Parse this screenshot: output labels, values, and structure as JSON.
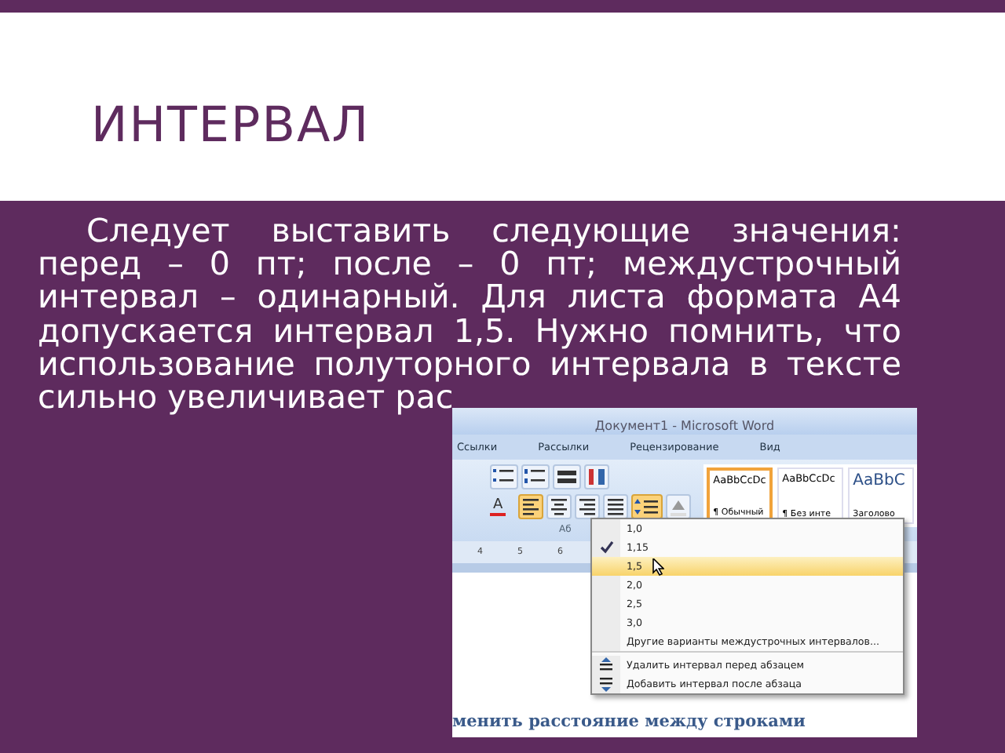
{
  "slide": {
    "title": "ИНТЕРВАЛ",
    "paragraph": "Следует выставить следующие значения: перед – 0 пт; после – 0 пт; междустрочный интервал – одинарный. Для листа формата А4 допускается интервал 1,5. Нужно помнить, что использование полуторного интервала в тексте сильно увеличивает рас"
  },
  "screenshot": {
    "window_title": "Документ1 - Microsoft Word",
    "tabs": [
      {
        "label": "Ссылки"
      },
      {
        "label": "Рассылки"
      },
      {
        "label": "Рецензирование"
      },
      {
        "label": "Вид"
      }
    ],
    "font_color_glyph": "A",
    "group_label": "Аб",
    "styles": [
      {
        "sample": "AaBbCcDc",
        "name": "¶ Обычный",
        "selected": true
      },
      {
        "sample": "AaBbCcDc",
        "name": "¶ Без инте",
        "selected": false
      },
      {
        "sample": "AaBbC",
        "name": "Заголово",
        "selected": false
      }
    ],
    "ruler_labels": [
      "4",
      "5",
      "6"
    ],
    "menu": [
      {
        "kind": "value",
        "label": "1,0",
        "checked": false,
        "selected": false
      },
      {
        "kind": "value",
        "label": "1,15",
        "checked": true,
        "selected": false
      },
      {
        "kind": "value",
        "label": "1,5",
        "checked": false,
        "selected": true
      },
      {
        "kind": "value",
        "label": "2,0",
        "checked": false,
        "selected": false
      },
      {
        "kind": "value",
        "label": "2,5",
        "checked": false,
        "selected": false
      },
      {
        "kind": "value",
        "label": "3,0",
        "checked": false,
        "selected": false
      },
      {
        "kind": "command",
        "label": "Другие варианты междустрочных интервалов...",
        "checked": false,
        "selected": false
      },
      {
        "kind": "remove",
        "label": "Удалить интервал перед абзацем",
        "checked": false,
        "selected": false
      },
      {
        "kind": "add",
        "label": "Добавить интервал после абзаца",
        "checked": false,
        "selected": false
      }
    ],
    "document_text": "менить расстояние между строками"
  }
}
